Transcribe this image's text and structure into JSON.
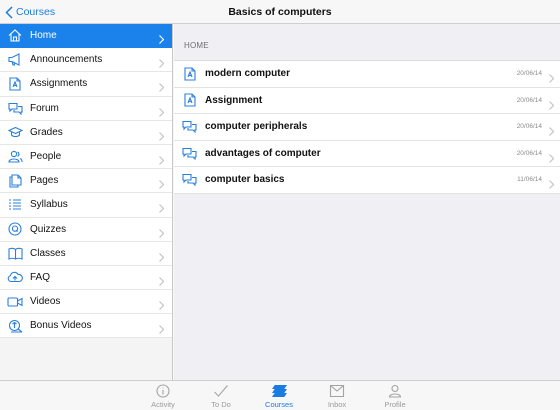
{
  "nav": {
    "back_label": "Courses",
    "title": "Basics of computers"
  },
  "sidebar": {
    "items": [
      {
        "label": "Home",
        "icon": "home-icon",
        "active": true
      },
      {
        "label": "Announcements",
        "icon": "megaphone-icon"
      },
      {
        "label": "Assignments",
        "icon": "document-icon"
      },
      {
        "label": "Forum",
        "icon": "chat-bubbles-icon"
      },
      {
        "label": "Grades",
        "icon": "graduation-cap-icon"
      },
      {
        "label": "People",
        "icon": "people-icon"
      },
      {
        "label": "Pages",
        "icon": "pages-icon"
      },
      {
        "label": "Syllabus",
        "icon": "list-icon"
      },
      {
        "label": "Quizzes",
        "icon": "quiz-icon"
      },
      {
        "label": "Classes",
        "icon": "book-icon"
      },
      {
        "label": "FAQ",
        "icon": "cloud-icon"
      },
      {
        "label": "Videos",
        "icon": "video-camera-icon"
      },
      {
        "label": "Bonus Videos",
        "icon": "bonus-icon"
      }
    ]
  },
  "main": {
    "section_header": "HOME",
    "rows": [
      {
        "title": "modern computer",
        "date": "20/06/14",
        "icon": "document-icon"
      },
      {
        "title": "Assignment",
        "date": "20/06/14",
        "icon": "document-icon"
      },
      {
        "title": "computer peripherals",
        "date": "20/06/14",
        "icon": "chat-bubbles-icon"
      },
      {
        "title": "advantages of computer",
        "date": "20/06/14",
        "icon": "chat-bubbles-icon"
      },
      {
        "title": "computer basics",
        "date": "11/06/14",
        "icon": "chat-bubbles-icon"
      }
    ]
  },
  "tabbar": {
    "tabs": [
      {
        "label": "Activity",
        "icon": "info-icon"
      },
      {
        "label": "To Do",
        "icon": "checkmark-icon"
      },
      {
        "label": "Courses",
        "icon": "courses-icon",
        "active": true
      },
      {
        "label": "Inbox",
        "icon": "inbox-icon"
      },
      {
        "label": "Profile",
        "icon": "person-icon"
      }
    ]
  },
  "colors": {
    "accent": "#1a82ea",
    "icon_blue": "#2a7fdc",
    "background": "#efeff4"
  }
}
